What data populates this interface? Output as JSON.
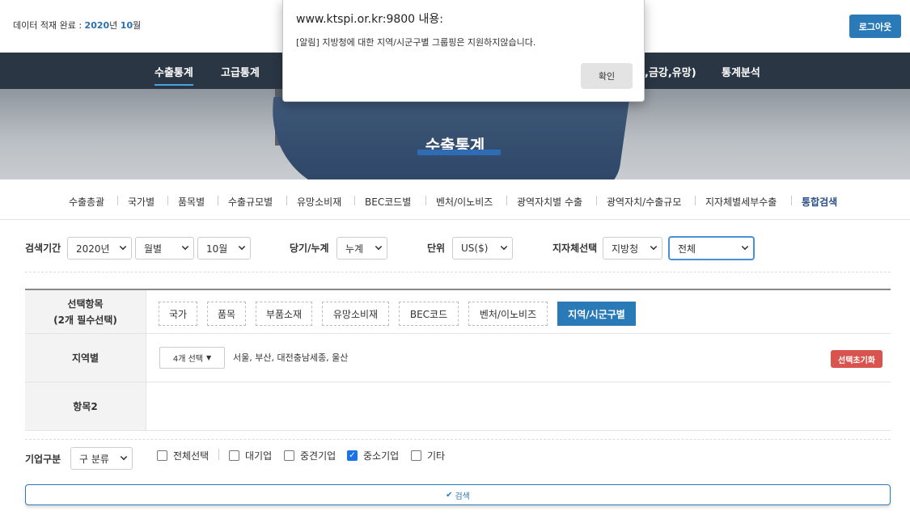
{
  "header": {
    "status_prefix": "데이터 적재 완료 : ",
    "status_year": "2020",
    "status_year_unit": "년 ",
    "status_month": "10",
    "status_month_unit": "월",
    "logout_label": "로그아웃"
  },
  "gnb": {
    "items": [
      "수출통계",
      "고급통계",
      ",금강,유망)",
      "통계분석"
    ]
  },
  "hero": {
    "title": "수출통계"
  },
  "subnav": {
    "items": [
      "수출총괄",
      "국가별",
      "품목별",
      "수출규모별",
      "유망소비재",
      "BEC코드별",
      "벤처/이노비즈",
      "광역자치별 수출",
      "광역자치/수출규모",
      "지자체별세부수출",
      "통합검색"
    ],
    "active_index": 10
  },
  "filters": {
    "period_label": "검색기간",
    "year": "2020년",
    "period_type": "월별",
    "month": "10월",
    "cumulative_label": "당기/누계",
    "cumulative": "누계",
    "unit_label": "단위",
    "unit": "US($)",
    "local_label": "지자체선택",
    "local_type": "지방청",
    "local_value": "전체"
  },
  "table": {
    "select_header_line1": "선택항목",
    "select_header_line2": "(2개 필수선택)",
    "chips": [
      "국가",
      "품목",
      "부품소재",
      "유망소비재",
      "BEC코드",
      "벤처/이노비즈",
      "지역/시군구별"
    ],
    "region_header": "지역별",
    "region_select": "4개 선택",
    "region_text": "서울, 부산, 대전충남세종, 울산",
    "reset_label": "선택초기화",
    "item2_header": "항목2"
  },
  "company": {
    "label": "기업구분",
    "classification": "구 분류",
    "options": [
      {
        "label": "전체선택",
        "checked": false
      },
      {
        "label": "대기업",
        "checked": false
      },
      {
        "label": "중견기업",
        "checked": false
      },
      {
        "label": "중소기업",
        "checked": true
      },
      {
        "label": "기타",
        "checked": false
      }
    ]
  },
  "search_label": "검색",
  "dialog": {
    "title": "www.ktspi.or.kr:9800 내용:",
    "message": "[알림] 지방청에 대한 지역/시군구별 그룹핑은 지원하지않습니다.",
    "ok_label": "확인"
  }
}
